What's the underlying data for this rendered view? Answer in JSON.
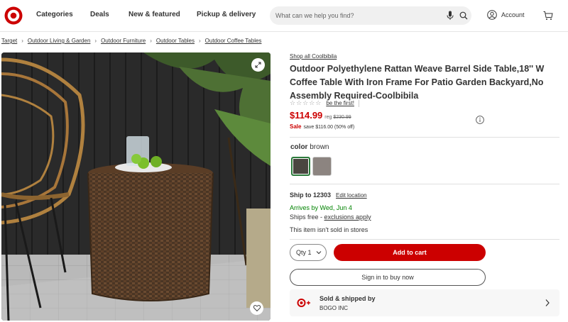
{
  "header": {
    "nav": [
      "Categories",
      "Deals",
      "New & featured",
      "Pickup & delivery"
    ],
    "search_placeholder": "What can we help you find?",
    "account_label": "Account"
  },
  "breadcrumb": [
    "Target",
    "Outdoor Living & Garden",
    "Outdoor Furniture",
    "Outdoor Tables",
    "Outdoor Coffee Tables"
  ],
  "product": {
    "shop_all": "Shop all Coolbibila",
    "title": "Outdoor Polyethylene Rattan Weave Barrel Side Table,18'' W Coffee Table With Iron Frame For Patio Garden Backyard,No Assembly Required-Coolbibila",
    "rating_stars": "☆☆☆☆☆",
    "be_first": "be the first!",
    "price": "$114.99",
    "reg_label": "reg",
    "reg_price": "$230.99",
    "sale_label": "Sale",
    "save_text": "save $116.00 (50% off)",
    "color_label": "color",
    "color_value": "brown",
    "swatch_colors": [
      "#4a4640",
      "#8c8480"
    ]
  },
  "fulfillment": {
    "ship_to_label": "Ship to 12303",
    "edit_location": "Edit location",
    "arrives": "Arrives by Wed, Jun 4",
    "ships_free": "Ships free - ",
    "exclusions": "exclusions apply",
    "not_sold": "This item isn't sold in stores"
  },
  "actions": {
    "qty_label": "Qty",
    "qty_value": "1",
    "add_to_cart": "Add to cart",
    "sign_in": "Sign in to buy now"
  },
  "seller": {
    "title": "Sold & shipped by",
    "name": "BOGO INC"
  },
  "colors": {
    "brand_red": "#cc0000",
    "success_green": "#008300"
  }
}
